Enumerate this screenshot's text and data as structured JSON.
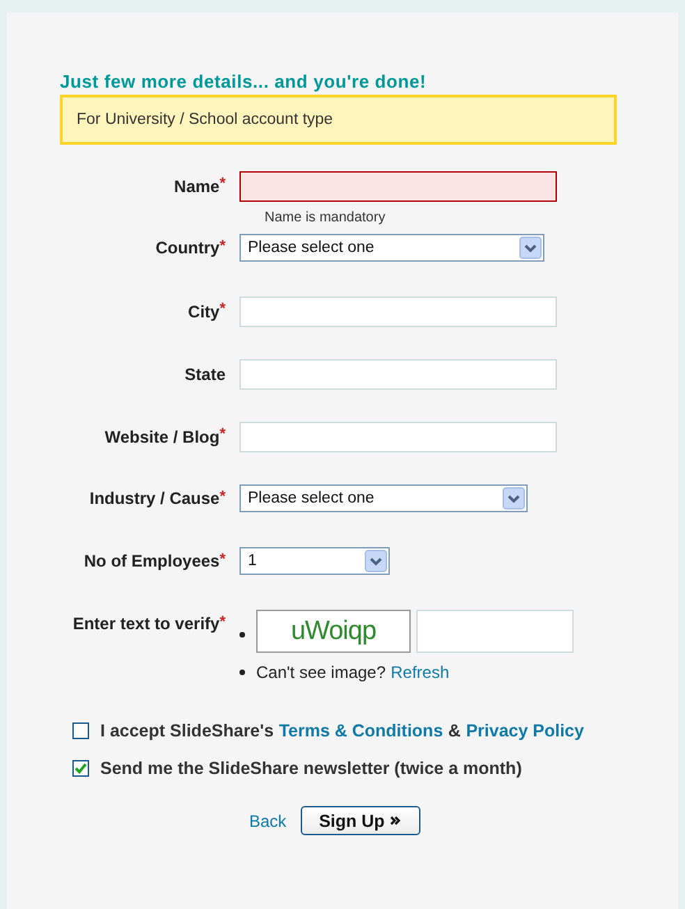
{
  "heading": "Just few more details... and you're done!",
  "notice": "For University / School account type",
  "fields": [
    {
      "kind": "text",
      "label": "Name",
      "required_mark": "*",
      "error": true,
      "error_text": "Name is mandatory"
    },
    {
      "kind": "select",
      "label": "Country",
      "required_mark": "*",
      "value": "Please select one"
    },
    {
      "kind": "text",
      "label": "City",
      "required_mark": "*",
      "error": false
    },
    {
      "kind": "text",
      "label": "State",
      "error": false
    },
    {
      "kind": "text",
      "label": "Website / Blog",
      "required_mark": "*",
      "error": false
    },
    {
      "kind": "select",
      "label": "Industry / Cause",
      "required_mark": "*",
      "value": "Please select one"
    },
    {
      "kind": "select",
      "label": "No of Employees",
      "required_mark": "*",
      "value": "1"
    },
    {
      "kind": "captcha",
      "label": "Enter text to verify",
      "required_mark": "*",
      "captcha_text": "uWoiqp",
      "hint": [
        {
          "kind": "text",
          "text": "Can't see image?"
        },
        {
          "kind": "link",
          "text": "Refresh"
        }
      ]
    }
  ],
  "checkboxes": [
    {
      "checked": false,
      "parts": [
        {
          "kind": "text",
          "text": "I accept SlideShare's"
        },
        {
          "kind": "link",
          "text": "Terms & Conditions"
        },
        {
          "kind": "text",
          "text": "&"
        },
        {
          "kind": "link",
          "text": "Privacy Policy"
        }
      ]
    },
    {
      "checked": true,
      "parts": [
        {
          "kind": "text",
          "text": "Send me the SlideShare newsletter (twice a month)"
        }
      ]
    }
  ],
  "back_link": "Back",
  "submit_button": "Sign Up"
}
